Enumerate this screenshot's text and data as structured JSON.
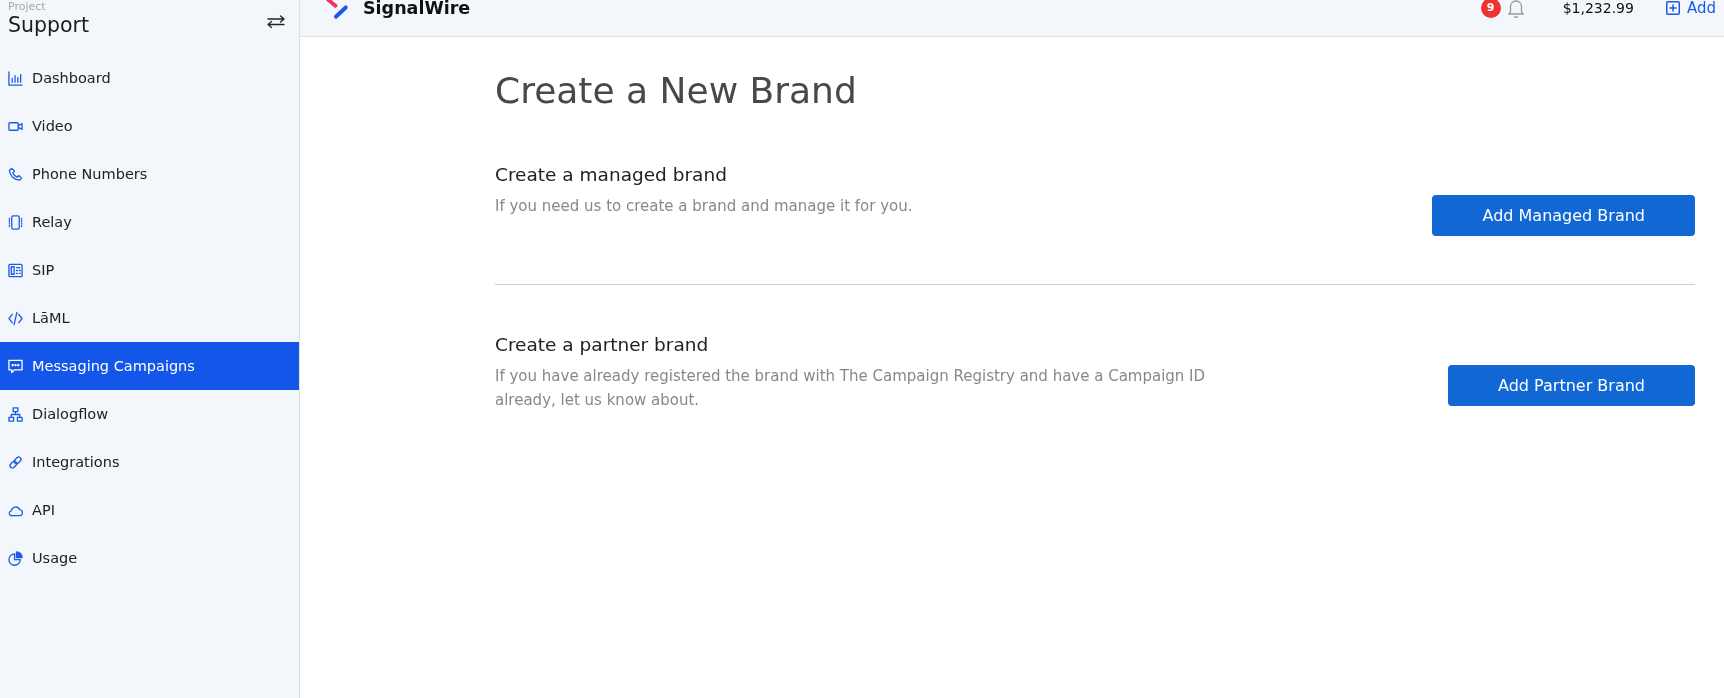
{
  "sidebar": {
    "project_label": "Project",
    "project_name": "Support",
    "nav_items": [
      {
        "label": "Dashboard",
        "selected": false
      },
      {
        "label": "Video",
        "selected": false
      },
      {
        "label": "Phone Numbers",
        "selected": false
      },
      {
        "label": "Relay",
        "selected": false
      },
      {
        "label": "SIP",
        "selected": false
      },
      {
        "label": "LāML",
        "selected": false
      },
      {
        "label": "Messaging Campaigns",
        "selected": true
      },
      {
        "label": "Dialogflow",
        "selected": false
      },
      {
        "label": "Integrations",
        "selected": false
      },
      {
        "label": "API",
        "selected": false
      },
      {
        "label": "Usage",
        "selected": false
      }
    ]
  },
  "top_bar": {
    "logo_text": "SignalWire",
    "notification_count": "9",
    "balance": "$1,232.99",
    "add_link": "Add"
  },
  "page": {
    "title": "Create a New Brand",
    "sections": [
      {
        "heading": "Create a managed brand",
        "description": "If you need us to create a brand and manage it for you.",
        "button": "Add Managed Brand"
      },
      {
        "heading": "Create a partner brand",
        "description": "If you have already registered the brand with The Campaign Registry and have a Campaign ID already, let us know about.",
        "button": "Add Partner Brand"
      }
    ]
  }
}
